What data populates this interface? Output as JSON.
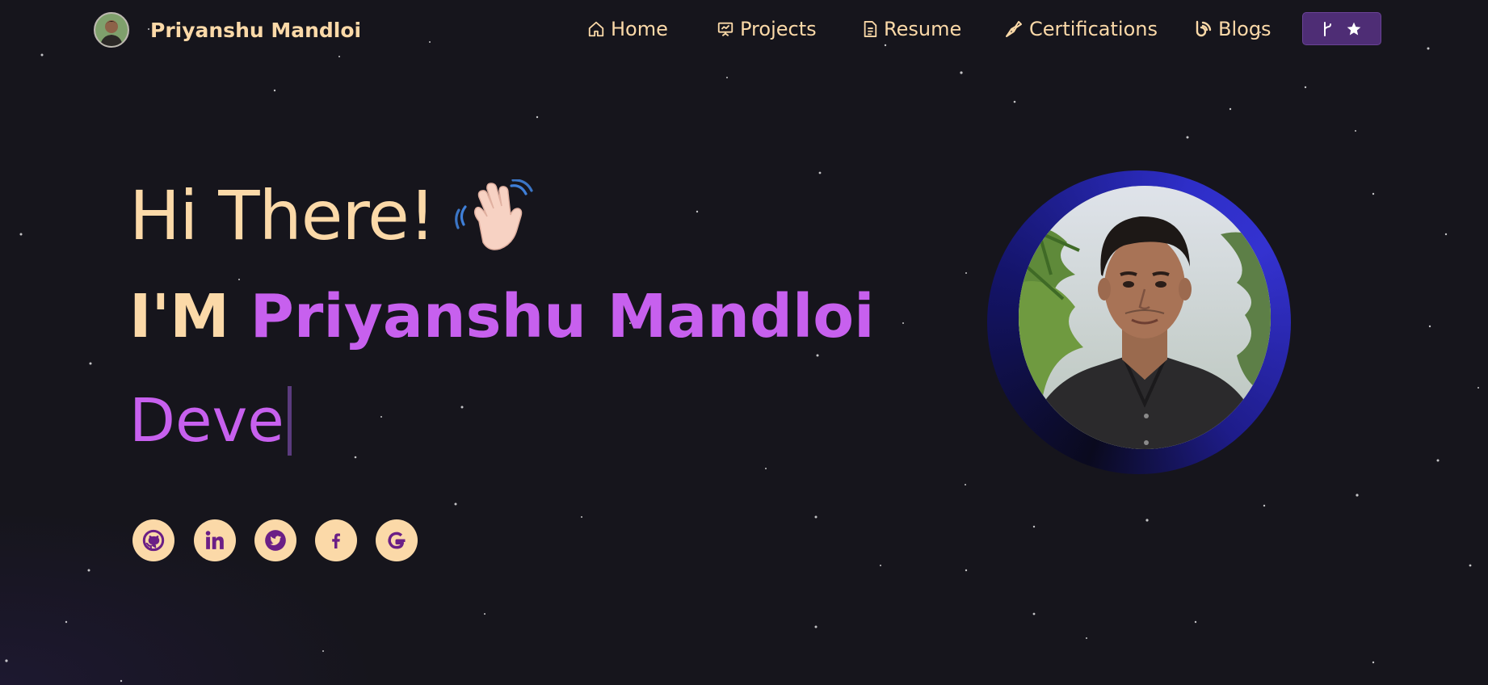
{
  "brand": {
    "name": "Priyanshu Mandloi"
  },
  "nav": {
    "home": "Home",
    "projects": "Projects",
    "resume": "Resume",
    "certifications": "Certifications",
    "blogs": "Blogs"
  },
  "hero": {
    "greeting": "Hi There!",
    "im_prefix": "I'M ",
    "name": "Priyanshu Mandloi",
    "typed_text": "Deve"
  },
  "socials": [
    "github-icon",
    "linkedin-icon",
    "twitter-icon",
    "facebook-icon",
    "google-icon"
  ],
  "colors": {
    "background": "#16151c",
    "accent_text": "#fbd9a8",
    "highlight": "#c760ee",
    "fork_button": "#4e2d75",
    "social_icon": "#6b1f86",
    "ring": "#2e2ec8"
  }
}
